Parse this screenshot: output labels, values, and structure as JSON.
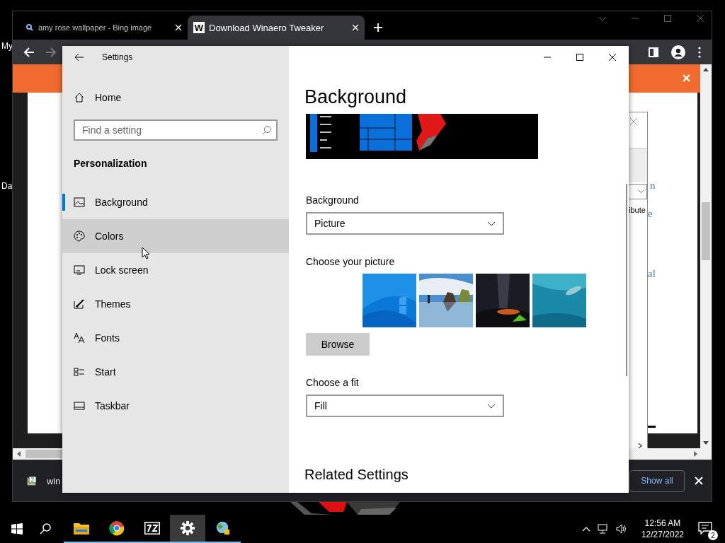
{
  "desktop": {
    "icon_labels": [
      "My",
      "Da"
    ]
  },
  "browser": {
    "tabs": [
      {
        "kind": "search",
        "title": "amy rose wallpaper - Bing image",
        "selected": false
      },
      {
        "kind": "site",
        "favicon": "W",
        "title": "Download Winaero Tweaker",
        "selected": true
      }
    ],
    "forward_disabled": true,
    "page": {
      "popup_text": "ibute",
      "links": [
        "n",
        "e",
        "al"
      ]
    },
    "downloads": {
      "items": [
        {
          "name": "win"
        }
      ],
      "show_all": "Show all"
    }
  },
  "settings": {
    "title": "Settings",
    "home": "Home",
    "search": {
      "placeholder": "Find a setting"
    },
    "section": "Personalization",
    "nav": [
      {
        "label": "Background",
        "selected": true,
        "hovered": false
      },
      {
        "label": "Colors",
        "selected": false,
        "hovered": true
      },
      {
        "label": "Lock screen",
        "selected": false,
        "hovered": false
      },
      {
        "label": "Themes",
        "selected": false,
        "hovered": false
      },
      {
        "label": "Fonts",
        "selected": false,
        "hovered": false
      },
      {
        "label": "Start",
        "selected": false,
        "hovered": false
      },
      {
        "label": "Taskbar",
        "selected": false,
        "hovered": false
      }
    ],
    "heading": "Background",
    "background": {
      "label": "Background",
      "value": "Picture"
    },
    "choose_picture": "Choose your picture",
    "browse": "Browse",
    "fit": {
      "label": "Choose a fit",
      "value": "Fill"
    },
    "related": "Related Settings"
  },
  "taskbar": {
    "apps": [
      {
        "running": true,
        "active": false
      },
      {
        "running": true,
        "active": false
      },
      {
        "running": true,
        "active": false
      },
      {
        "running": true,
        "active": true
      },
      {
        "running": true,
        "active": false
      }
    ],
    "time": "12:56 AM",
    "date": "12/27/2022",
    "notifications": "2"
  }
}
